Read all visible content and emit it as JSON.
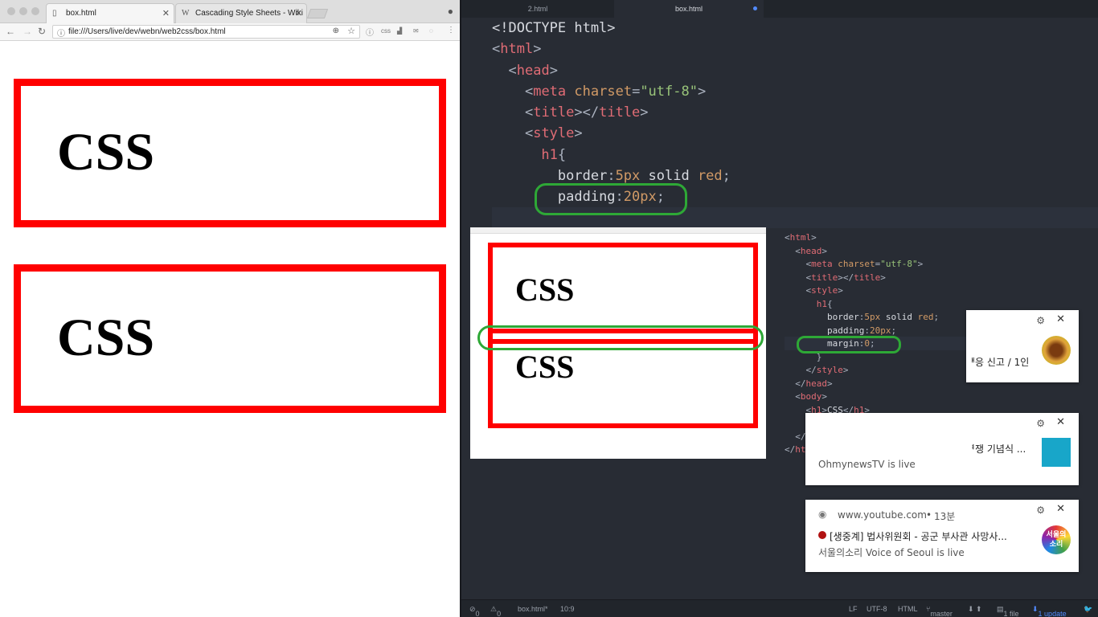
{
  "browser": {
    "tabs": [
      {
        "label": "box.html",
        "icon": "document-icon"
      },
      {
        "label": "Cascading Style Sheets - Wiki",
        "icon": "wikipedia-icon"
      }
    ],
    "url": "file:///Users/live/dev/webn/web2css/box.html",
    "page": {
      "headings": [
        "CSS",
        "CSS"
      ]
    }
  },
  "editor": {
    "tabs": [
      "2.html",
      "box.html"
    ],
    "code": {
      "doctype": "<!DOCTYPE html>",
      "charset": "\"utf-8\"",
      "border_value": "5px",
      "border_rest": " solid ",
      "border_color": "red",
      "padding_value": "20px"
    },
    "embedded": {
      "headings": [
        "CSS",
        "CSS"
      ],
      "charset": "\"utf-8\"",
      "border_value": "5px",
      "border_color": "red",
      "padding_value": "20px",
      "margin_value": "0",
      "h1_text": "CSS"
    },
    "status": {
      "errors": "0",
      "warnings": "0",
      "file": "box.html*",
      "position": "10:9",
      "line_ending": "LF",
      "encoding": "UTF-8",
      "grammar": "HTML",
      "branch": "master",
      "files": "1 file",
      "update": "1 update"
    }
  },
  "notifications": [
    {
      "text": "ᅢ응 신고 / 1인",
      "subtext": ""
    },
    {
      "text": "ᅧ쟁 기념식 ...",
      "subtext": "OhmynewsTV is live"
    },
    {
      "source": "www.youtube.com",
      "time": "13분",
      "text": "[생중계] 법사위원회 - 공군 부사관 사망사...",
      "subtext": "서울의소리 Voice of Seoul is live",
      "thumb_text": "서울의\n소리"
    }
  ],
  "colors": {
    "box_border": "#ff0000",
    "annotation": "#2ea836",
    "editor_bg": "#282c34"
  }
}
